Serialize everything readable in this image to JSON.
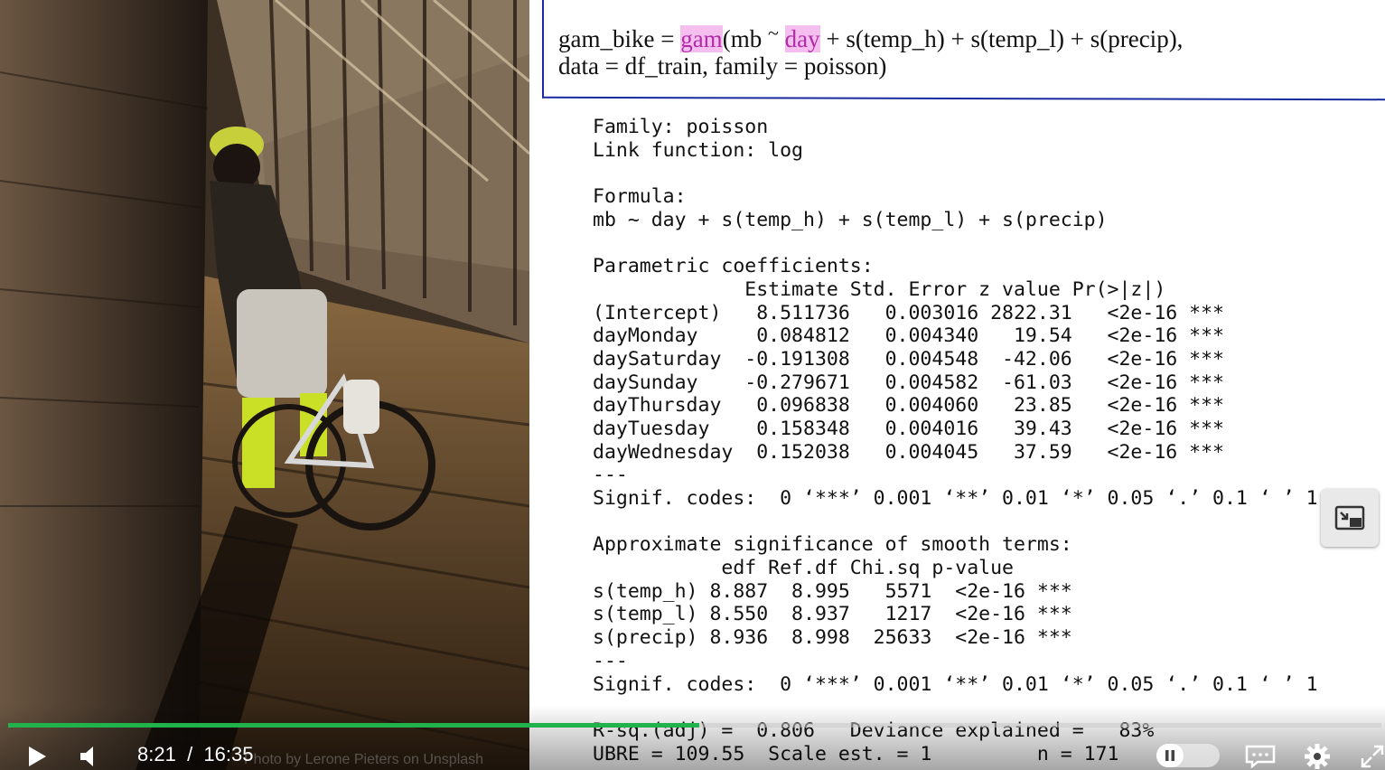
{
  "photo": {
    "credit": "Photo by Lerone Pieters on Unsplash"
  },
  "slide": {
    "formula_line1_prefix": "gam_bike = ",
    "formula_line1_gam": "gam",
    "formula_line1_mid": "(mb ",
    "formula_line1_tilde": "~",
    "formula_line1_space": " ",
    "formula_line1_day": "day",
    "formula_line1_rest": " + s(temp_h) + s(temp_l) + s(precip),",
    "formula_line2": "data = df_train, family = poisson)",
    "highlight_color": "#b02da8",
    "border_color": "#1c2aa0",
    "output_lines": [
      "Family: poisson",
      "Link function: log",
      "",
      "Formula:",
      "mb ~ day + s(temp_h) + s(temp_l) + s(precip)",
      "",
      "Parametric coefficients:",
      "             Estimate Std. Error z value Pr(>|z|)",
      "(Intercept)   8.511736   0.003016 2822.31   <2e-16 ***",
      "dayMonday     0.084812   0.004340   19.54   <2e-16 ***",
      "daySaturday  -0.191308   0.004548  -42.06   <2e-16 ***",
      "daySunday    -0.279671   0.004582  -61.03   <2e-16 ***",
      "dayThursday   0.096838   0.004060   23.85   <2e-16 ***",
      "dayTuesday    0.158348   0.004016   39.43   <2e-16 ***",
      "dayWednesday  0.152038   0.004045   37.59   <2e-16 ***",
      "---",
      "Signif. codes:  0 ‘***’ 0.001 ‘**’ 0.01 ‘*’ 0.05 ‘.’ 0.1 ‘ ’ 1",
      "",
      "Approximate significance of smooth terms:",
      "           edf Ref.df Chi.sq p-value",
      "s(temp_h) 8.887  8.995   5571  <2e-16 ***",
      "s(temp_l) 8.550  8.937   1217  <2e-16 ***",
      "s(precip) 8.936  8.998  25633  <2e-16 ***",
      "---",
      "Signif. codes:  0 ‘***’ 0.001 ‘**’ 0.01 ‘*’ 0.05 ‘.’ 0.1 ‘ ’ 1",
      "",
      "R-sq.(adj) =  0.806   Deviance explained =   83%",
      "UBRE = 109.55  Scale est. = 1         n = 171"
    ]
  },
  "player": {
    "current_time": "8:21",
    "separator": "/",
    "duration": "16:35",
    "progress_fraction": 0.503,
    "progress_color": "#22b24c",
    "icons": {
      "play": "play-icon",
      "volume": "volume-icon",
      "pause": "pause-icon",
      "captions": "captions-icon",
      "settings": "gear-icon",
      "fullscreen": "fullscreen-icon",
      "pip": "picture-in-picture-icon"
    }
  }
}
